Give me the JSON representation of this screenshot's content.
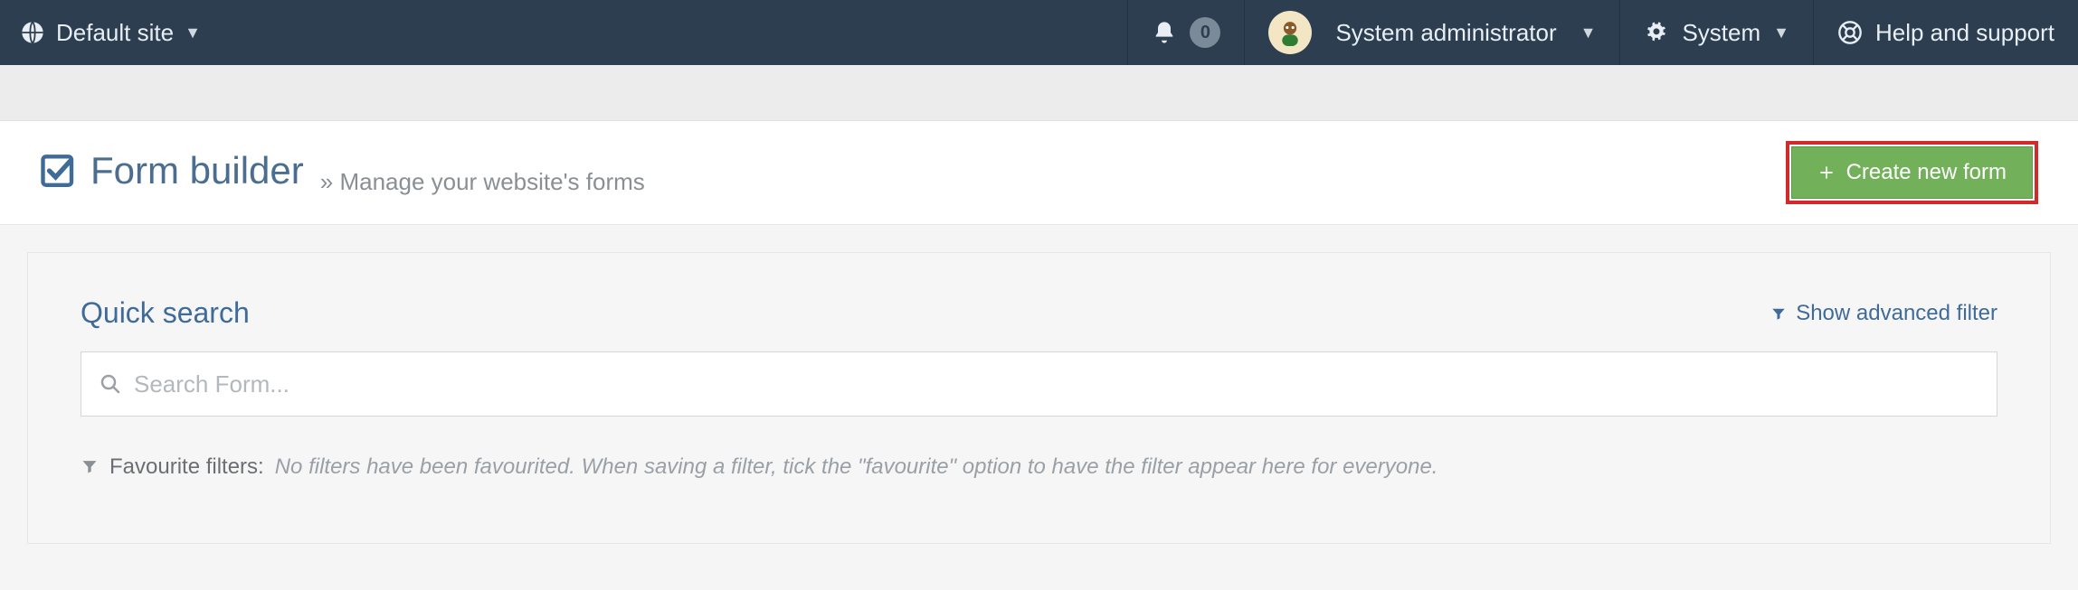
{
  "topbar": {
    "site_label": "Default site",
    "notification_count": "0",
    "user_label": "System administrator",
    "system_label": "System",
    "help_label": "Help and support"
  },
  "page": {
    "title": "Form builder",
    "subtitle_prefix": "»",
    "subtitle": "Manage your website's forms",
    "create_button": "Create new form"
  },
  "search": {
    "title": "Quick search",
    "advanced_label": "Show advanced filter",
    "placeholder": "Search Form..."
  },
  "filters": {
    "label": "Favourite filters:",
    "empty_message": "No filters have been favourited. When saving a filter, tick the \"favourite\" option to have the filter appear here for everyone."
  }
}
